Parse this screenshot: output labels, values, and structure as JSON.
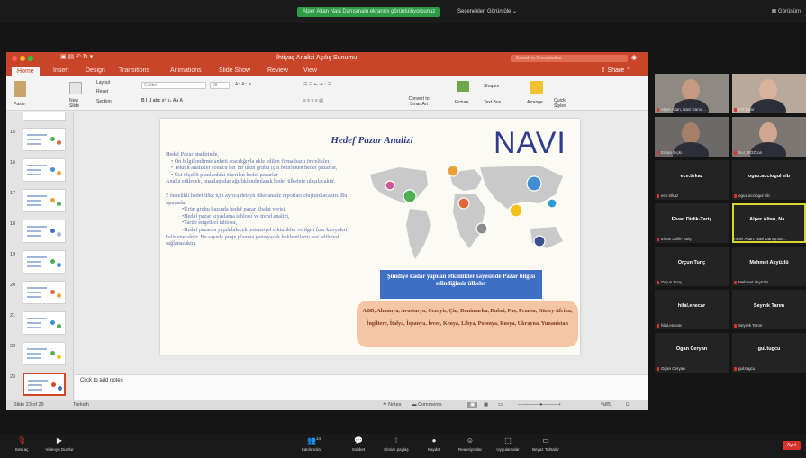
{
  "zoom": {
    "share_banner": "Alper Altan Nasi Danışmaln ekranını görüntülüyorsunuz",
    "view_options": "Seçenekleri Görüntüle",
    "top_right": "Görünüm",
    "leave_label": "Ayrıl",
    "toolbar": [
      "Sesi aç",
      "Videoyu Durdur",
      "Katılımcılar",
      "Sohbet",
      "Ekranı paylaş",
      "Kaydet",
      "Reaksiyonlar",
      "Uygulamalar",
      "Beyaz Tahtalar"
    ],
    "participant_count": "14"
  },
  "powerpoint": {
    "doc_title": "İhtiyaç Analizi Açılış Sunumu",
    "search_placeholder": "Search in Presentation",
    "share_label": "Share",
    "tabs": [
      "Home",
      "Insert",
      "Design",
      "Transitions",
      "Animations",
      "Slide Show",
      "Review",
      "View"
    ],
    "ribbon": {
      "paste": "Paste",
      "new_slide": "New Slide",
      "layout": "Layout",
      "reset": "Reset",
      "section": "Section",
      "font_name": "Calibri",
      "font_size": "28",
      "convert_smartart": "Convert to SmartArt",
      "picture": "Picture",
      "text_box": "Text Box",
      "shapes": "Shapes",
      "arrange": "Arrange",
      "quick_styles": "Quick Styles"
    },
    "thumbnails": [
      "15",
      "16",
      "17",
      "18",
      "19",
      "20",
      "21",
      "22",
      "23"
    ],
    "notes_placeholder": "Click to add notes",
    "status": {
      "slide_counter": "Slide 23 of 29",
      "language": "Turkish",
      "notes": "Notes",
      "comments": "Comments",
      "zoom": "%85"
    }
  },
  "slide": {
    "title": "Hedef Pazar Analizi",
    "logo": "NAVI",
    "body": {
      "intro": "Hedef Pazar analizinde,",
      "bullet1": "• Ön bilgilendirme anketi aracılığıyla ekle edilen firma bazlı öncelikler,",
      "bullet2": "• Teknik analizler sonucu her bir ürün grubu için belirlenen hedef pazarlar,",
      "bullet3": "• Üst ölçekli planlardaki önerilen hedef pazarlar",
      "line4": "Analiz edilecek, puanlamalar ağırlıklandırılarak hedef ülkelere ulaşılacaktır.",
      "para2": "5 öncelikli hedef ülke için ayrıca detaylı ülke analiz raporları oluşturulacaktır. Bu aşamada;",
      "sub1": "•Ürün grubu bazında hedef pazar ithalat verisi,",
      "sub2": "•Hedef pazar kıyaslama tablosu ve trend analizi,",
      "sub3": "•Tarife engelleri tablosu,",
      "sub4": "•Hedef pazarda yapılabilecek potansiyel etkinlikler ve ilgili fuar künyeleri",
      "outro": "belirlenecektir. Bu sayede proje planına yansıyacak beklentilerin test edilmesi sağlanacaktır."
    },
    "banner": "Şimdiye kadar yapılan etkinlikler sayesinde Pazar bilgisi edindiğimiz ülkeler",
    "countries": "ABD, Almanya, Avustarya, Cezayir, Çin, Danimarka, Dubai, Fas, Fransa, Güney Afrika, İngiltere, İtalya, İspanya, İsveç, Kenya, Libya, Polonya, Rusya, Ukrayna, Yunanistan",
    "map_pin_colors": [
      "#e9a23b",
      "#4caf50",
      "#e2683c",
      "#3f8ed6",
      "#8c8c8c",
      "#f4c21f",
      "#c95a96",
      "#3d4f8c",
      "#2c9bd6"
    ]
  },
  "participants": [
    {
      "name": "Alper Altan, Navi Danış...",
      "type": "video"
    },
    {
      "name": "Elif Tatar",
      "type": "video"
    },
    {
      "name": "Erhan Bıçkı",
      "type": "video"
    },
    {
      "name": "Nur_BOZcan",
      "type": "video"
    },
    {
      "name": "ece.tirkaz",
      "sub": "ece.tirkaz",
      "type": "name"
    },
    {
      "name": "oguz.acciogul eib",
      "sub": "oguz.acciogul eib",
      "type": "name"
    },
    {
      "name": "Eivan Dirlik-Tariş",
      "sub": "Eivan Dirlik-Tariş",
      "type": "name"
    },
    {
      "name": "Alper Altan, Na...",
      "sub": "Alper Altan, Navi Danışman...",
      "type": "name",
      "active": true
    },
    {
      "name": "Orçun Tunç",
      "sub": "Orçun Tunç",
      "type": "name"
    },
    {
      "name": "Mehmet Akyüzlü",
      "sub": "Mehmet Akyüzlü",
      "type": "name"
    },
    {
      "name": "hilal.enecar",
      "sub": "hilal.enecar",
      "type": "name"
    },
    {
      "name": "Seyrek Tarım",
      "sub": "Seyrek Tarım",
      "type": "name"
    },
    {
      "name": "Ogan Ceryan",
      "sub": "Ogan Ceryan",
      "type": "name"
    },
    {
      "name": "gul.tugcu",
      "sub": "gul.tugcu",
      "type": "name"
    }
  ],
  "colors": {
    "ppt_accent": "#c8452a",
    "slide_title": "#2b3b8f",
    "banner": "#3f6fc4",
    "countries_bg": "#f4c6a6",
    "zoom_green": "#2e9b46",
    "leave_red": "#d9312b"
  }
}
